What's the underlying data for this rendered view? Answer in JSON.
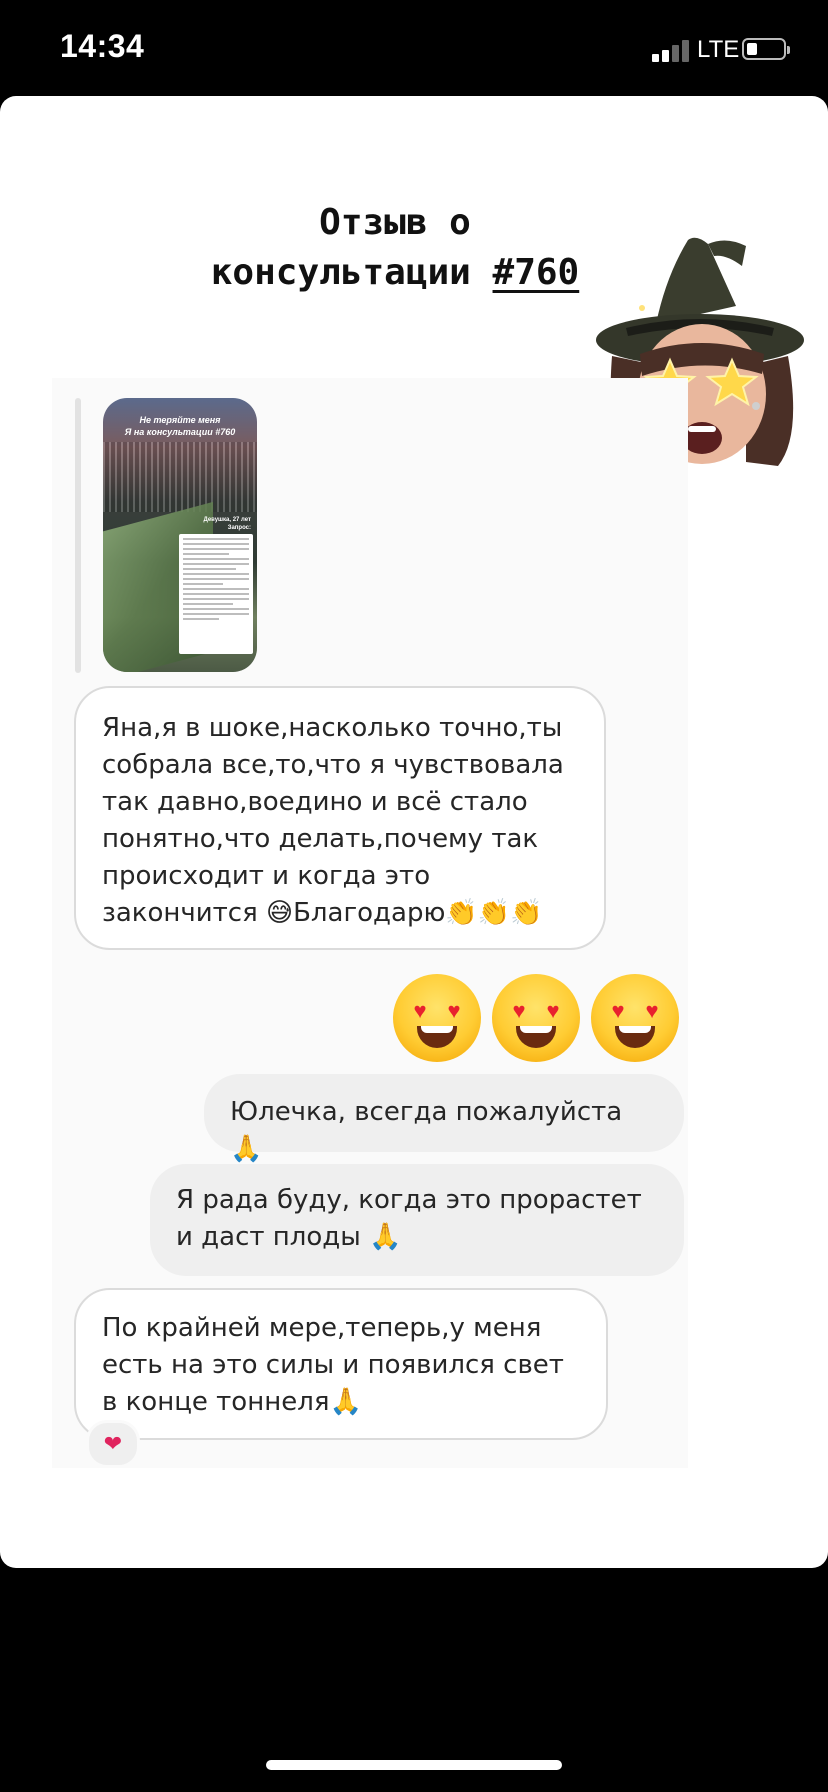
{
  "status_bar": {
    "time": "14:34",
    "network": "LTE"
  },
  "story": {
    "title_line1": "Отзыв о",
    "title_line2": "консультации",
    "hashtag": "#760"
  },
  "shared_story": {
    "title": "Не теряйте меня\nЯ на консультации #760",
    "caption": "Девушка, 27 лет\nЗапрос:"
  },
  "messages": [
    {
      "sender": "them",
      "text": "Яна,я в шоке,насколько точно,ты собрала все,то,что я чувствовала так давно,воедино и всё стало понятно,что делать,почему так происходит и когда это закончится 😅Благодарю👏👏👏"
    },
    {
      "sender": "me",
      "text": "😍😍😍"
    },
    {
      "sender": "me",
      "text": "Юлечка, всегда пожалуйста 🙏"
    },
    {
      "sender": "me",
      "text": "Я рада буду, когда это прорастет и даст плоды 🙏"
    },
    {
      "sender": "them",
      "text": "По крайней мере,теперь,у меня есть на это силы и появился свет в конце тоннеля🙏"
    }
  ],
  "reaction": "❤"
}
